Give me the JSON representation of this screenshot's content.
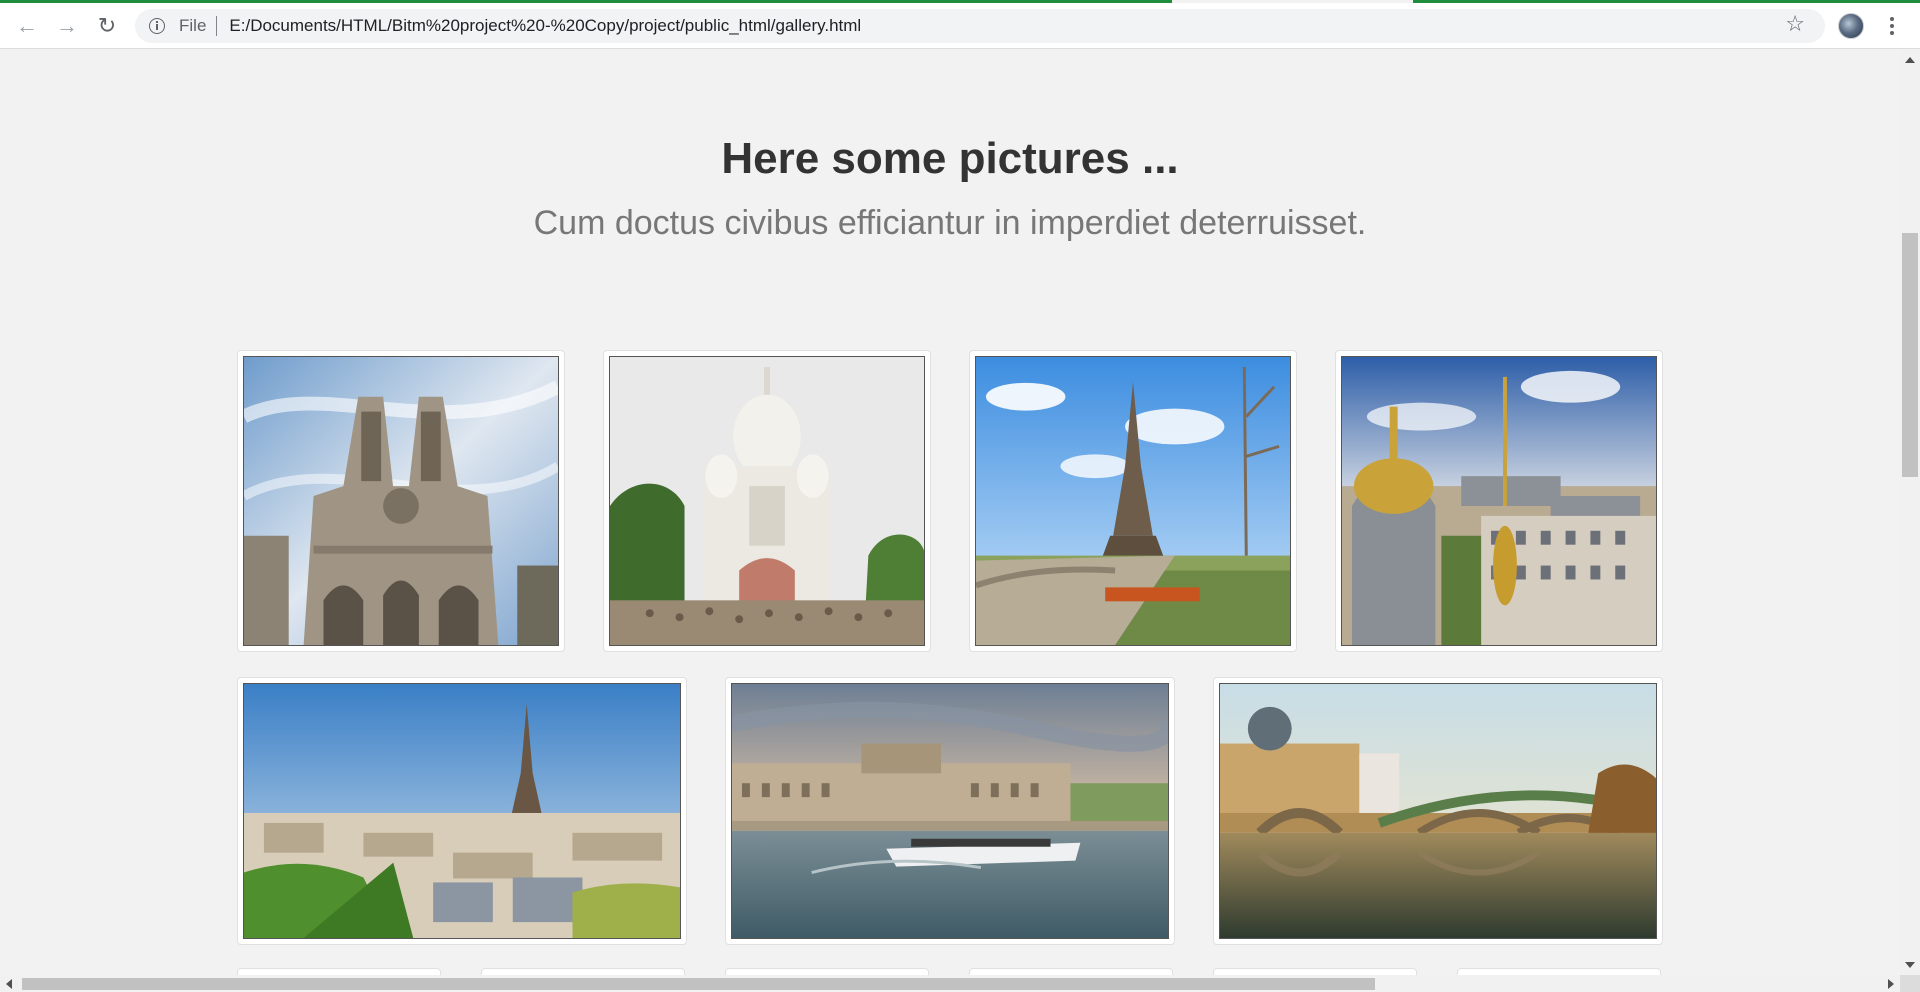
{
  "browser": {
    "scheme_label": "File",
    "url": "E:/Documents/HTML/Bitm%20project%20-%20Copy/project/public_html/gallery.html",
    "accent_color": "#1e8e3e"
  },
  "page": {
    "title": "Here some pictures ...",
    "subtitle": "Cum doctus civibus efficiantur in imperdiet deterruisset."
  },
  "gallery": {
    "row1": [
      {
        "subject": "Notre-Dame cathedral facade"
      },
      {
        "subject": "Sacré-Cœur basilica"
      },
      {
        "subject": "Eiffel Tower with bridge and river"
      },
      {
        "subject": "Paris rooftops with domes"
      }
    ],
    "row2": [
      {
        "subject": "Paris skyline with Eiffel Tower"
      },
      {
        "subject": "Musée d'Orsay and Seine boat"
      },
      {
        "subject": "Bridge over the Seine at sunset"
      }
    ]
  }
}
